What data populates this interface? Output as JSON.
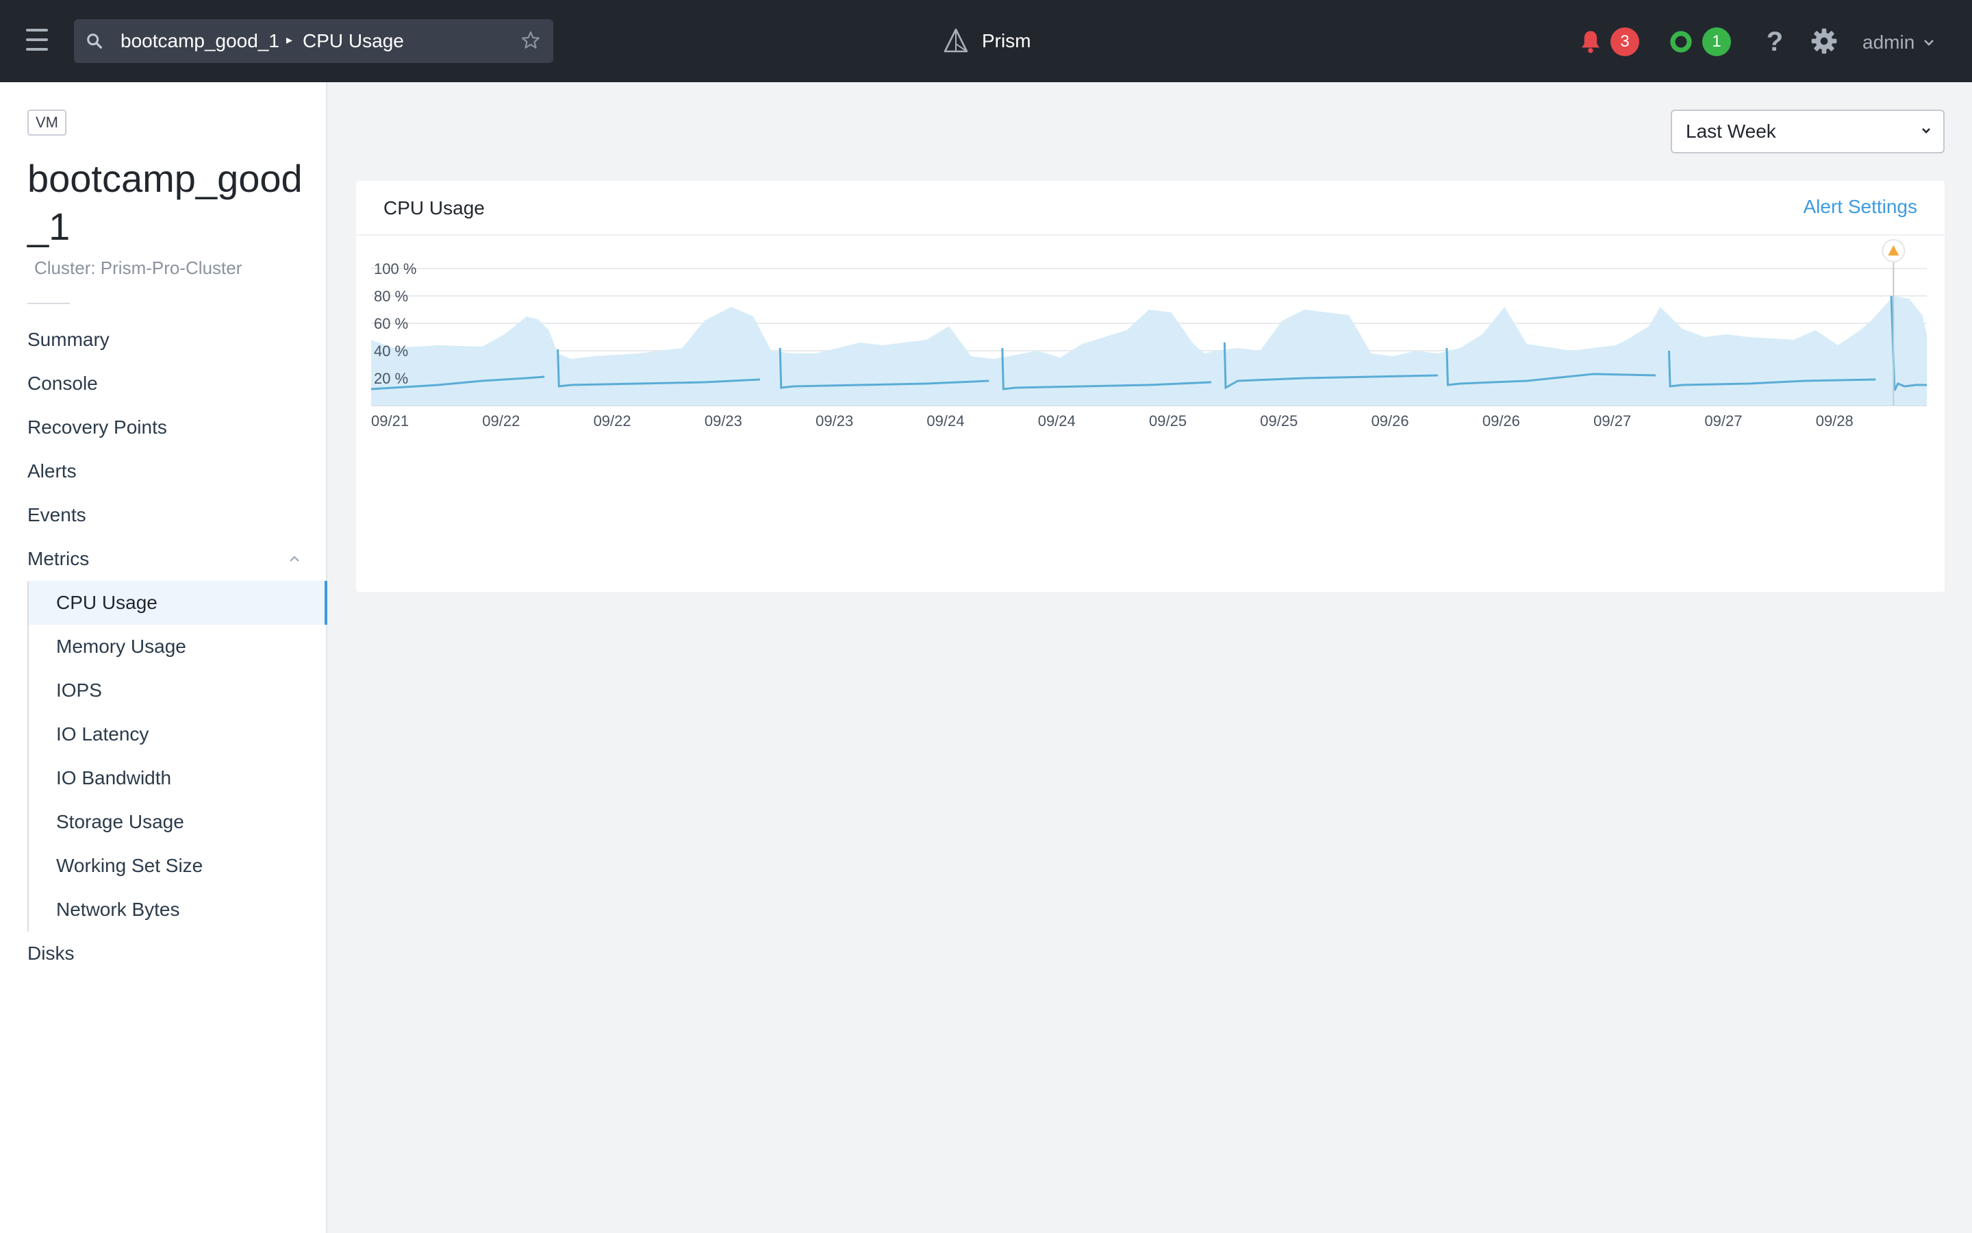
{
  "topbar": {
    "breadcrumb": [
      "bootcamp_good_1",
      "CPU Usage"
    ],
    "app_name": "Prism",
    "alert_count": "3",
    "health_count": "1",
    "help_label": "?",
    "user": "admin",
    "accent_alert": "#e5474b",
    "accent_health": "#38b449"
  },
  "sidebar": {
    "entity_type": "VM",
    "entity_name": "bootcamp_good_1",
    "cluster": "Cluster: Prism-Pro-Cluster",
    "nav": {
      "summary": "Summary",
      "console": "Console",
      "recovery_points": "Recovery Points",
      "alerts": "Alerts",
      "events": "Events",
      "metrics": "Metrics",
      "disks": "Disks"
    },
    "metrics": [
      "CPU Usage",
      "Memory Usage",
      "IOPS",
      "IO Latency",
      "IO Bandwidth",
      "Storage Usage",
      "Working Set Size",
      "Network Bytes"
    ],
    "active_metric": "CPU Usage"
  },
  "time_range": "Last Week",
  "card": {
    "title": "CPU Usage",
    "alert_settings": "Alert Settings"
  },
  "chart_data": {
    "type": "area",
    "title": "",
    "xlabel": "",
    "ylabel": "",
    "ylim": [
      0,
      100
    ],
    "y_ticks": [
      20,
      40,
      60,
      80,
      100
    ],
    "y_unit": " %",
    "x_ticks": [
      "09/21",
      "09/22",
      "09/22",
      "09/23",
      "09/23",
      "09/24",
      "09/24",
      "09/25",
      "09/25",
      "09/26",
      "09/26",
      "09/27",
      "09/27",
      "09/28"
    ],
    "x_range_days": [
      0,
      7
    ],
    "grid": true,
    "series": [
      {
        "role": "peak band",
        "color": "#d7ecf8",
        "x": [
          0,
          0.1,
          0.3,
          0.5,
          0.6,
          0.7,
          0.75,
          0.8,
          0.84,
          0.9,
          1.0,
          1.2,
          1.4,
          1.5,
          1.62,
          1.72,
          1.8,
          1.9,
          2.0,
          2.1,
          2.2,
          2.3,
          2.5,
          2.6,
          2.7,
          2.8,
          2.9,
          3.0,
          3.1,
          3.2,
          3.4,
          3.5,
          3.6,
          3.7,
          3.75,
          3.8,
          3.9,
          4.0,
          4.1,
          4.2,
          4.4,
          4.5,
          4.6,
          4.7,
          4.8,
          4.9,
          5.0,
          5.1,
          5.2,
          5.4,
          5.5,
          5.6,
          5.65,
          5.75,
          5.8,
          5.9,
          6.0,
          6.1,
          6.2,
          6.4,
          6.5,
          6.6,
          6.7,
          6.75,
          6.85,
          6.92,
          6.98,
          7.0
        ],
        "values": [
          48,
          42,
          44,
          43,
          52,
          65,
          63,
          55,
          38,
          34,
          36,
          38,
          42,
          62,
          72,
          65,
          40,
          38,
          38,
          42,
          46,
          44,
          48,
          58,
          36,
          34,
          37,
          40,
          35,
          45,
          55,
          70,
          68,
          45,
          38,
          40,
          42,
          40,
          62,
          70,
          66,
          38,
          36,
          40,
          38,
          42,
          52,
          72,
          45,
          40,
          42,
          44,
          48,
          58,
          72,
          56,
          50,
          52,
          50,
          48,
          55,
          44,
          55,
          62,
          80,
          78,
          66,
          52
        ]
      },
      {
        "role": "usage",
        "color": "#5aacd6",
        "segments": [
          {
            "x": [
              0,
              0.3,
              0.5,
              0.7,
              0.78
            ],
            "values": [
              12,
              15,
              18,
              20,
              21
            ]
          },
          {
            "x": [
              0.84,
              0.845,
              0.9,
              1.2,
              1.5,
              1.75
            ],
            "values": [
              41,
              14,
              15,
              16,
              17,
              19
            ]
          },
          {
            "x": [
              1.84,
              1.845,
              1.9,
              2.2,
              2.5,
              2.78
            ],
            "values": [
              42,
              13,
              14,
              15,
              16,
              18
            ]
          },
          {
            "x": [
              2.84,
              2.845,
              2.9,
              3.2,
              3.5,
              3.78
            ],
            "values": [
              42,
              12,
              13,
              14,
              15,
              17
            ]
          },
          {
            "x": [
              3.84,
              3.845,
              3.9,
              4.2,
              4.5,
              4.8
            ],
            "values": [
              46,
              13,
              18,
              20,
              21,
              22
            ]
          },
          {
            "x": [
              4.84,
              4.845,
              4.9,
              5.2,
              5.5,
              5.78
            ],
            "values": [
              42,
              15,
              16,
              18,
              23,
              22
            ]
          },
          {
            "x": [
              5.84,
              5.845,
              5.9,
              6.2,
              6.45,
              6.77
            ],
            "values": [
              40,
              14,
              15,
              16,
              18,
              19
            ]
          },
          {
            "x": [
              6.84,
              6.855,
              6.87,
              6.9,
              6.95,
              7.0
            ],
            "values": [
              80,
              11,
              16,
              14,
              15,
              15
            ]
          }
        ]
      }
    ],
    "threshold_marker": {
      "x": 6.85,
      "color": "#f2a93b"
    }
  }
}
